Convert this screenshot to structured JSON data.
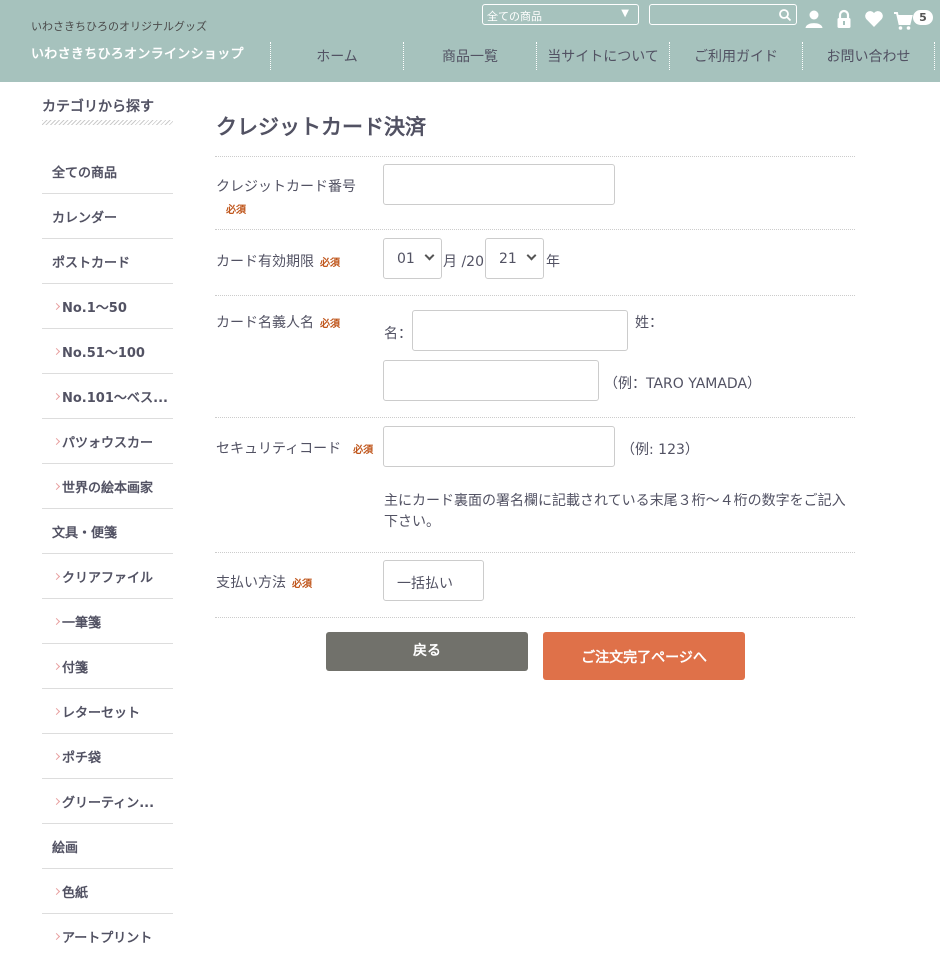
{
  "header": {
    "tagline": "いわさきちひろのオリジナルグッズ",
    "shop_name": "いわさきちひろオンラインショップ",
    "category_select": "全ての商品",
    "search_placeholder": "",
    "cart_count": "5",
    "nav": [
      "ホーム",
      "商品一覧",
      "当サイトについて",
      "ご利用ガイド",
      "お問い合わせ"
    ]
  },
  "sidebar": {
    "title": "カテゴリから探す",
    "items": [
      {
        "label": "全ての商品",
        "child": false
      },
      {
        "label": "カレンダー",
        "child": false
      },
      {
        "label": "ポストカード",
        "child": false
      },
      {
        "label": "No.1〜50",
        "child": true
      },
      {
        "label": "No.51〜100",
        "child": true
      },
      {
        "label": "No.101〜ベス...",
        "child": true
      },
      {
        "label": "パツォウスカー",
        "child": true
      },
      {
        "label": "世界の絵本画家",
        "child": true
      },
      {
        "label": "文具・便箋",
        "child": false
      },
      {
        "label": "クリアファイル",
        "child": true
      },
      {
        "label": "一筆箋",
        "child": true
      },
      {
        "label": "付箋",
        "child": true
      },
      {
        "label": "レターセット",
        "child": true
      },
      {
        "label": "ポチ袋",
        "child": true
      },
      {
        "label": "グリーティン...",
        "child": true
      },
      {
        "label": "絵画",
        "child": false
      },
      {
        "label": "色紙",
        "child": true
      },
      {
        "label": "アートプリント",
        "child": true
      }
    ]
  },
  "form": {
    "title": "クレジットカード決済",
    "required": "必須",
    "card_number_label": "クレジットカード番号",
    "expiry_label": "カード有効期限",
    "expiry_month": "01",
    "month_suffix": "月 /20",
    "expiry_year": "21",
    "year_suffix": "年",
    "holder_label": "カード名義人名",
    "first_name_label": "名：",
    "last_name_label": "姓：",
    "holder_example": "（例：TARO YAMADA）",
    "security_label": "セキュリティコード",
    "security_example": "（例: 123）",
    "security_note": "主にカード裏面の署名欄に記載されている末尾３桁〜４桁の数字をご記入下さい。",
    "payment_label": "支払い方法",
    "payment_value": "一括払い"
  },
  "buttons": {
    "back": "戻る",
    "next": "ご注文完了ページへ"
  }
}
